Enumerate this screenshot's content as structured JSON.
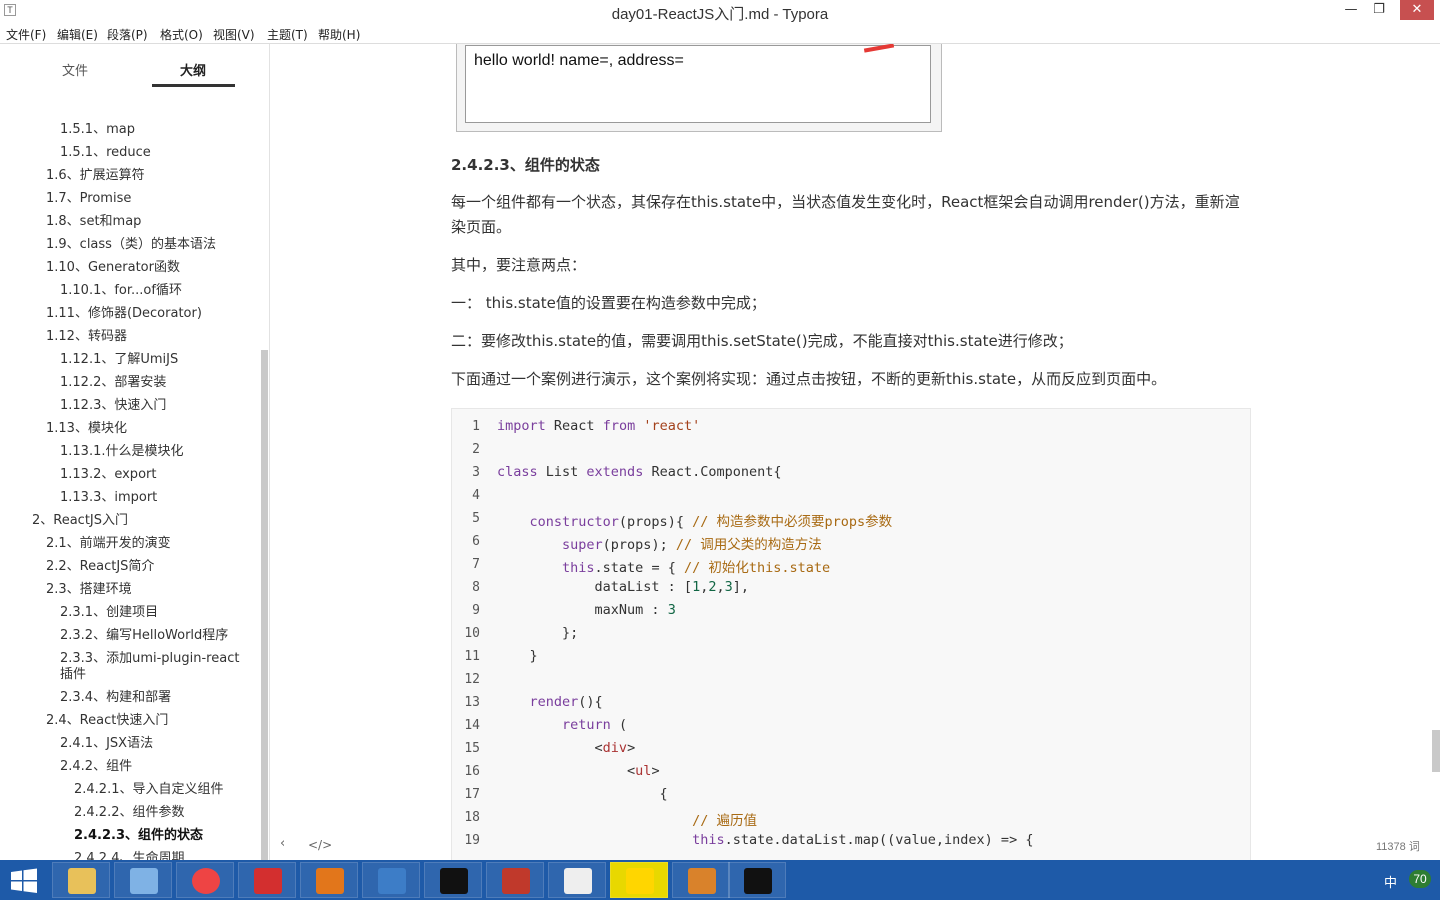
{
  "window": {
    "title": "day01-ReactJS入门.md - Typora",
    "app_icon": "T",
    "minimize_glyph": "—",
    "maximize_glyph": "❐",
    "close_glyph": "✕"
  },
  "menu": [
    "文件(F)",
    "编辑(E)",
    "段落(P)",
    "格式(O)",
    "视图(V)",
    "主题(T)",
    "帮助(H)"
  ],
  "sidebar": {
    "tabs": [
      "文件",
      "大纲"
    ],
    "active_tab": "大纲",
    "outline": [
      {
        "label": "1.5.1、map",
        "level": 2
      },
      {
        "label": "1.5.1、reduce",
        "level": 2
      },
      {
        "label": "1.6、扩展运算符",
        "level": 1
      },
      {
        "label": "1.7、Promise",
        "level": 1
      },
      {
        "label": "1.8、set和map",
        "level": 1
      },
      {
        "label": "1.9、class（类）的基本语法",
        "level": 1
      },
      {
        "label": "1.10、Generator函数",
        "level": 1
      },
      {
        "label": "1.10.1、for...of循环",
        "level": 2
      },
      {
        "label": "1.11、修饰器(Decorator)",
        "level": 1
      },
      {
        "label": "1.12、转码器",
        "level": 1
      },
      {
        "label": "1.12.1、了解UmiJS",
        "level": 2
      },
      {
        "label": "1.12.2、部署安装",
        "level": 2
      },
      {
        "label": "1.12.3、快速入门",
        "level": 2
      },
      {
        "label": "1.13、模块化",
        "level": 1
      },
      {
        "label": "1.13.1.什么是模块化",
        "level": 2
      },
      {
        "label": "1.13.2、export",
        "level": 2
      },
      {
        "label": "1.13.3、import",
        "level": 2
      },
      {
        "label": "2、ReactJS入门",
        "level": 0
      },
      {
        "label": "2.1、前端开发的演变",
        "level": 1
      },
      {
        "label": "2.2、ReactJS简介",
        "level": 1
      },
      {
        "label": "2.3、搭建环境",
        "level": 1
      },
      {
        "label": "2.3.1、创建项目",
        "level": 2
      },
      {
        "label": "2.3.2、编写HelloWorld程序",
        "level": 2
      },
      {
        "label": "2.3.3、添加umi-plugin-react",
        "level": 2
      },
      {
        "label": "插件",
        "level": 2
      },
      {
        "label": "2.3.4、构建和部署",
        "level": 2
      },
      {
        "label": "2.4、React快速入门",
        "level": 1
      },
      {
        "label": "2.4.1、JSX语法",
        "level": 2
      },
      {
        "label": "2.4.2、组件",
        "level": 2
      },
      {
        "label": "2.4.2.1、导入自定义组件",
        "level": 3
      },
      {
        "label": "2.4.2.2、组件参数",
        "level": 3
      },
      {
        "label": "2.4.2.3、组件的状态",
        "level": 3,
        "active": true
      },
      {
        "label": "2.4.2.4、生命周期",
        "level": 3
      }
    ]
  },
  "content": {
    "image_text": "hello world! name=, address=",
    "heading": "2.4.2.3、组件的状态",
    "paragraphs": [
      "每一个组件都有一个状态，其保存在this.state中，当状态值发生变化时，React框架会自动调用render()方法，重新渲染页面。",
      "其中，要注意两点：",
      "一： this.state值的设置要在构造参数中完成；",
      "二：要修改this.state的值，需要调用this.setState()完成，不能直接对this.state进行修改；",
      "下面通过一个案例进行演示，这个案例将实现：通过点击按钮，不断的更新this.state，从而反应到页面中。"
    ],
    "code_lines": [
      "import React from 'react'",
      "",
      "class List extends React.Component{",
      "",
      "    constructor(props){ // 构造参数中必须要props参数",
      "        super(props); // 调用父类的构造方法",
      "        this.state = { // 初始化this.state",
      "            dataList : [1,2,3],",
      "            maxNum : 3",
      "        };",
      "    }",
      "",
      "    render(){",
      "        return (",
      "            <div>",
      "                <ul>",
      "                    {",
      "                        // 遍历值",
      "                        this.state.dataList.map((value,index) => {"
    ]
  },
  "footer": {
    "back_glyph": "‹",
    "source_glyph": "</>",
    "word_count": "11378 词"
  },
  "taskbar": {
    "apps": [
      "file-explorer",
      "paint",
      "chrome",
      "xmind",
      "typora-alt",
      "sublime",
      "intellij",
      "archive",
      "typora",
      "potplayer",
      "another-app",
      "cmd"
    ],
    "tray_ime": "中",
    "tray_badge": "70"
  }
}
